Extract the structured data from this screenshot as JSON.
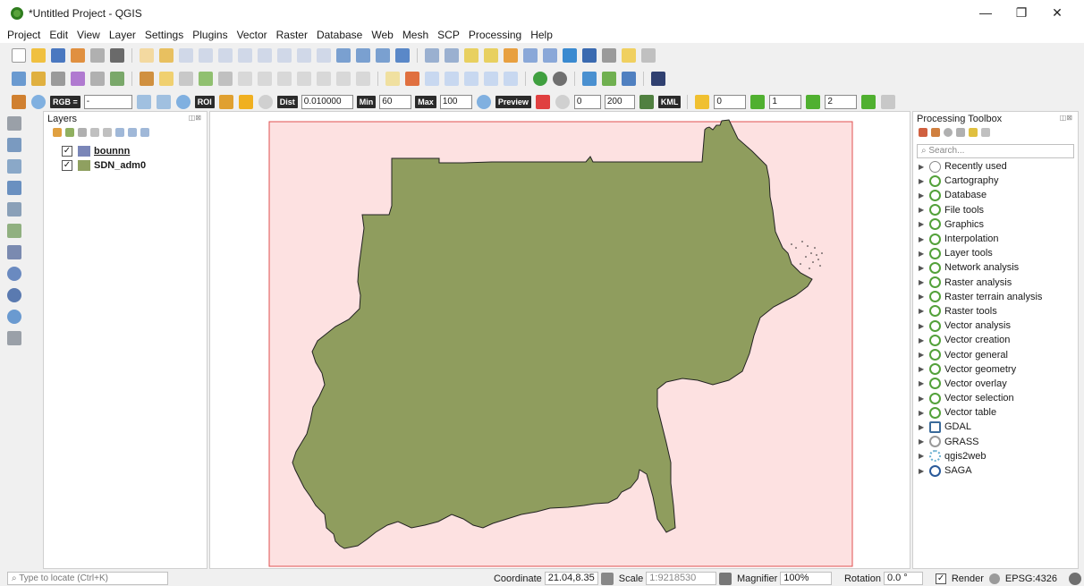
{
  "window": {
    "title": "*Untitled Project - QGIS",
    "minimize": "—",
    "maximize": "❐",
    "close": "✕"
  },
  "menu": [
    "Project",
    "Edit",
    "View",
    "Layer",
    "Settings",
    "Plugins",
    "Vector",
    "Raster",
    "Database",
    "Web",
    "Mesh",
    "SCP",
    "Processing",
    "Help"
  ],
  "scp_toolbar": {
    "rgb_label": "RGB =",
    "rgb_value": "-",
    "roi_label": "ROI",
    "dist_label": "Dist",
    "dist_value": "0.010000",
    "min_label": "Min",
    "min_value": "60",
    "max_label": "Max",
    "max_value": "100",
    "preview_label": "Preview",
    "t_value": "0",
    "s_value": "200",
    "kml_label": "KML",
    "band_values": [
      "0",
      "1",
      "2"
    ]
  },
  "layers_panel": {
    "title": "Layers",
    "items": [
      {
        "name": "bounnn",
        "checked": "✓",
        "color": "#7a86b8"
      },
      {
        "name": "SDN_adm0",
        "checked": "✓",
        "color": "#8fa060"
      }
    ]
  },
  "map": {
    "fill": "#8f9d5e",
    "bbox_fill": "#fde1e1",
    "bbox_stroke": "#e05050"
  },
  "toolbox": {
    "title": "Processing Toolbox",
    "search_placeholder": "Search...",
    "items": [
      "Recently used",
      "Cartography",
      "Database",
      "File tools",
      "Graphics",
      "Interpolation",
      "Layer tools",
      "Network analysis",
      "Raster analysis",
      "Raster terrain analysis",
      "Raster tools",
      "Vector analysis",
      "Vector creation",
      "Vector general",
      "Vector geometry",
      "Vector overlay",
      "Vector selection",
      "Vector table",
      "GDAL",
      "GRASS",
      "qgis2web",
      "SAGA"
    ]
  },
  "statusbar": {
    "locator_placeholder": "Type to locate (Ctrl+K)",
    "coordinate_label": "Coordinate",
    "coordinate_value": "21.04,8.35",
    "scale_label": "Scale",
    "scale_value": "1:9218530",
    "magnifier_label": "Magnifier",
    "magnifier_value": "100%",
    "rotation_label": "Rotation",
    "rotation_value": "0.0 °",
    "render_label": "Render",
    "render_checked": "✓",
    "crs_label": "EPSG:4326"
  }
}
